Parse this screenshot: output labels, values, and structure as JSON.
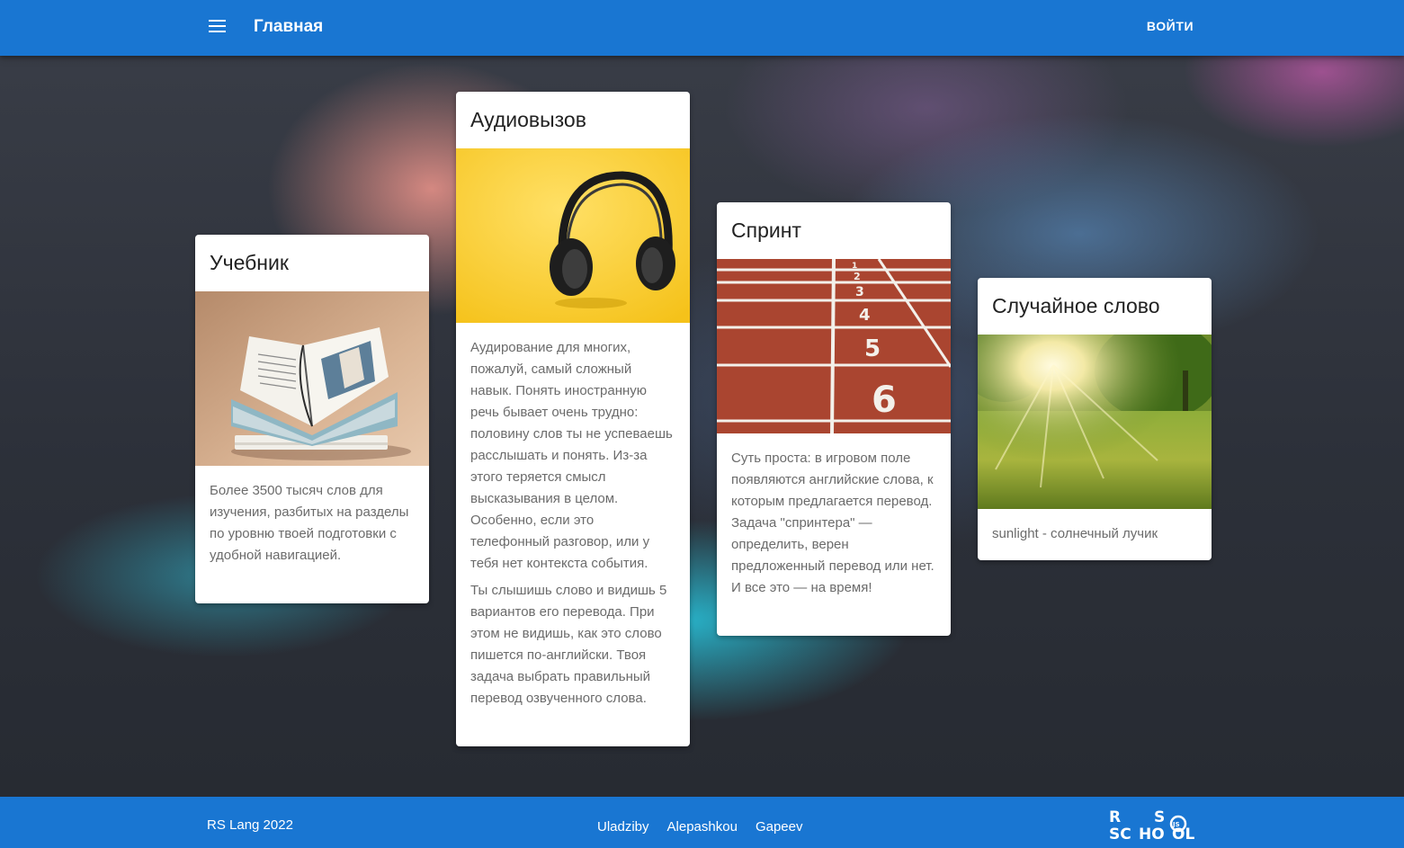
{
  "header": {
    "title": "Главная",
    "login_label": "ВОЙТИ",
    "menu_icon": "menu-icon"
  },
  "cards": [
    {
      "title": "Учебник",
      "image": "open-book-photo",
      "text": [
        "Более 3500 тысяч слов для изучения, разбитых на разделы по уровню твоей подготовки с удобной навигацией."
      ]
    },
    {
      "title": "Аудиовызов",
      "image": "headphones-photo",
      "text": [
        "Аудирование для многих, пожалуй, самый сложный навык. Понять иностранную речь бывает очень трудно: половину слов ты не успеваешь расслышать и понять. Из-за этого теряется смысл высказывания в целом. Особенно, если это телефонный разговор, или у тебя нет контекста события.",
        "Ты слышишь слово и видишь 5 вариантов его перевода. При этом не видишь, как это слово пишется по-английски. Твоя задача выбрать правильный перевод озвученного слова."
      ]
    },
    {
      "title": "Спринт",
      "image": "running-track-photo",
      "text": [
        "Суть проста: в игровом поле появляются английские слова, к которым предлагается перевод. Задача \"спринтера\" — определить, верен предложенный перевод или нет. И все это — на время!"
      ]
    },
    {
      "title": "Случайное слово",
      "image": "sunlit-meadow-photo",
      "text": [
        "sunlight - солнечный лучик"
      ]
    }
  ],
  "footer": {
    "copyright": "RS Lang 2022",
    "authors": [
      "Uladziby",
      "Alepashkou",
      "Gapeev"
    ],
    "logo": "rs-school-logo",
    "logo_text": "RS SCHOOL JS"
  },
  "colors": {
    "primary": "#1976d2",
    "card_text": "#6b6b6b",
    "card_title": "#222222"
  }
}
